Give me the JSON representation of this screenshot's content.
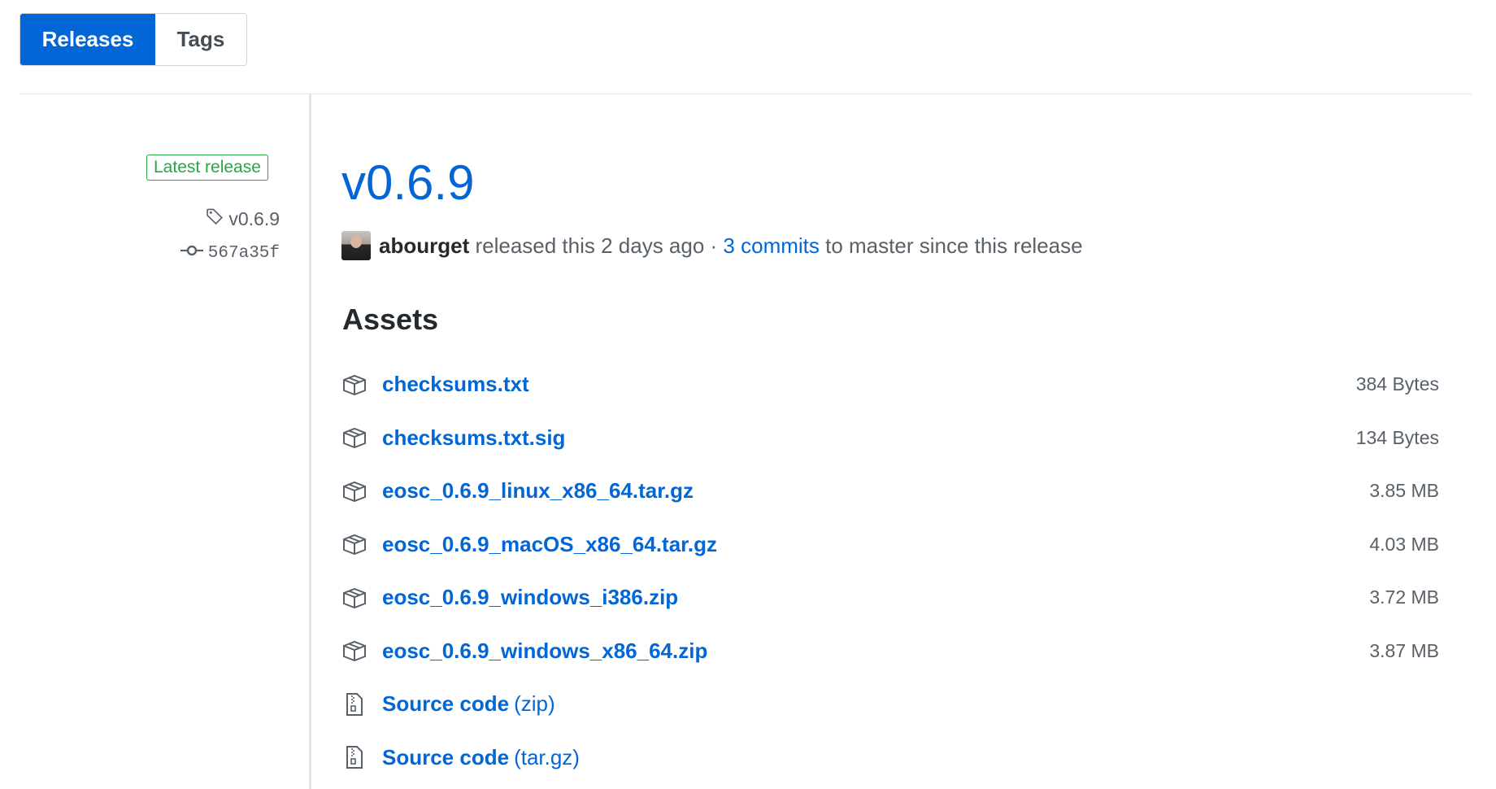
{
  "tabs": [
    {
      "label": "Releases",
      "active": true
    },
    {
      "label": "Tags",
      "active": false
    }
  ],
  "release": {
    "badge": "Latest release",
    "tag": "v0.6.9",
    "commit": "567a35f",
    "title": "v0.6.9",
    "author": "abourget",
    "released_text": " released this 2 days ago · ",
    "commits_link": "3 commits",
    "commits_suffix": " to master since this release"
  },
  "assets_heading": "Assets",
  "assets": [
    {
      "name": "checksums.txt",
      "size": "384 Bytes",
      "icon": "package-icon"
    },
    {
      "name": "checksums.txt.sig",
      "size": "134 Bytes",
      "icon": "package-icon"
    },
    {
      "name": "eosc_0.6.9_linux_x86_64.tar.gz",
      "size": "3.85 MB",
      "icon": "package-icon"
    },
    {
      "name": "eosc_0.6.9_macOS_x86_64.tar.gz",
      "size": "4.03 MB",
      "icon": "package-icon"
    },
    {
      "name": "eosc_0.6.9_windows_i386.zip",
      "size": "3.72 MB",
      "icon": "package-icon"
    },
    {
      "name": "eosc_0.6.9_windows_x86_64.zip",
      "size": "3.87 MB",
      "icon": "package-icon"
    },
    {
      "name": "Source code",
      "suffix": "(zip)",
      "icon": "file-zip-icon"
    },
    {
      "name": "Source code",
      "suffix": "(tar.gz)",
      "icon": "file-zip-icon"
    }
  ],
  "colors": {
    "accent": "#0366d6",
    "badge_green": "#28a745"
  }
}
